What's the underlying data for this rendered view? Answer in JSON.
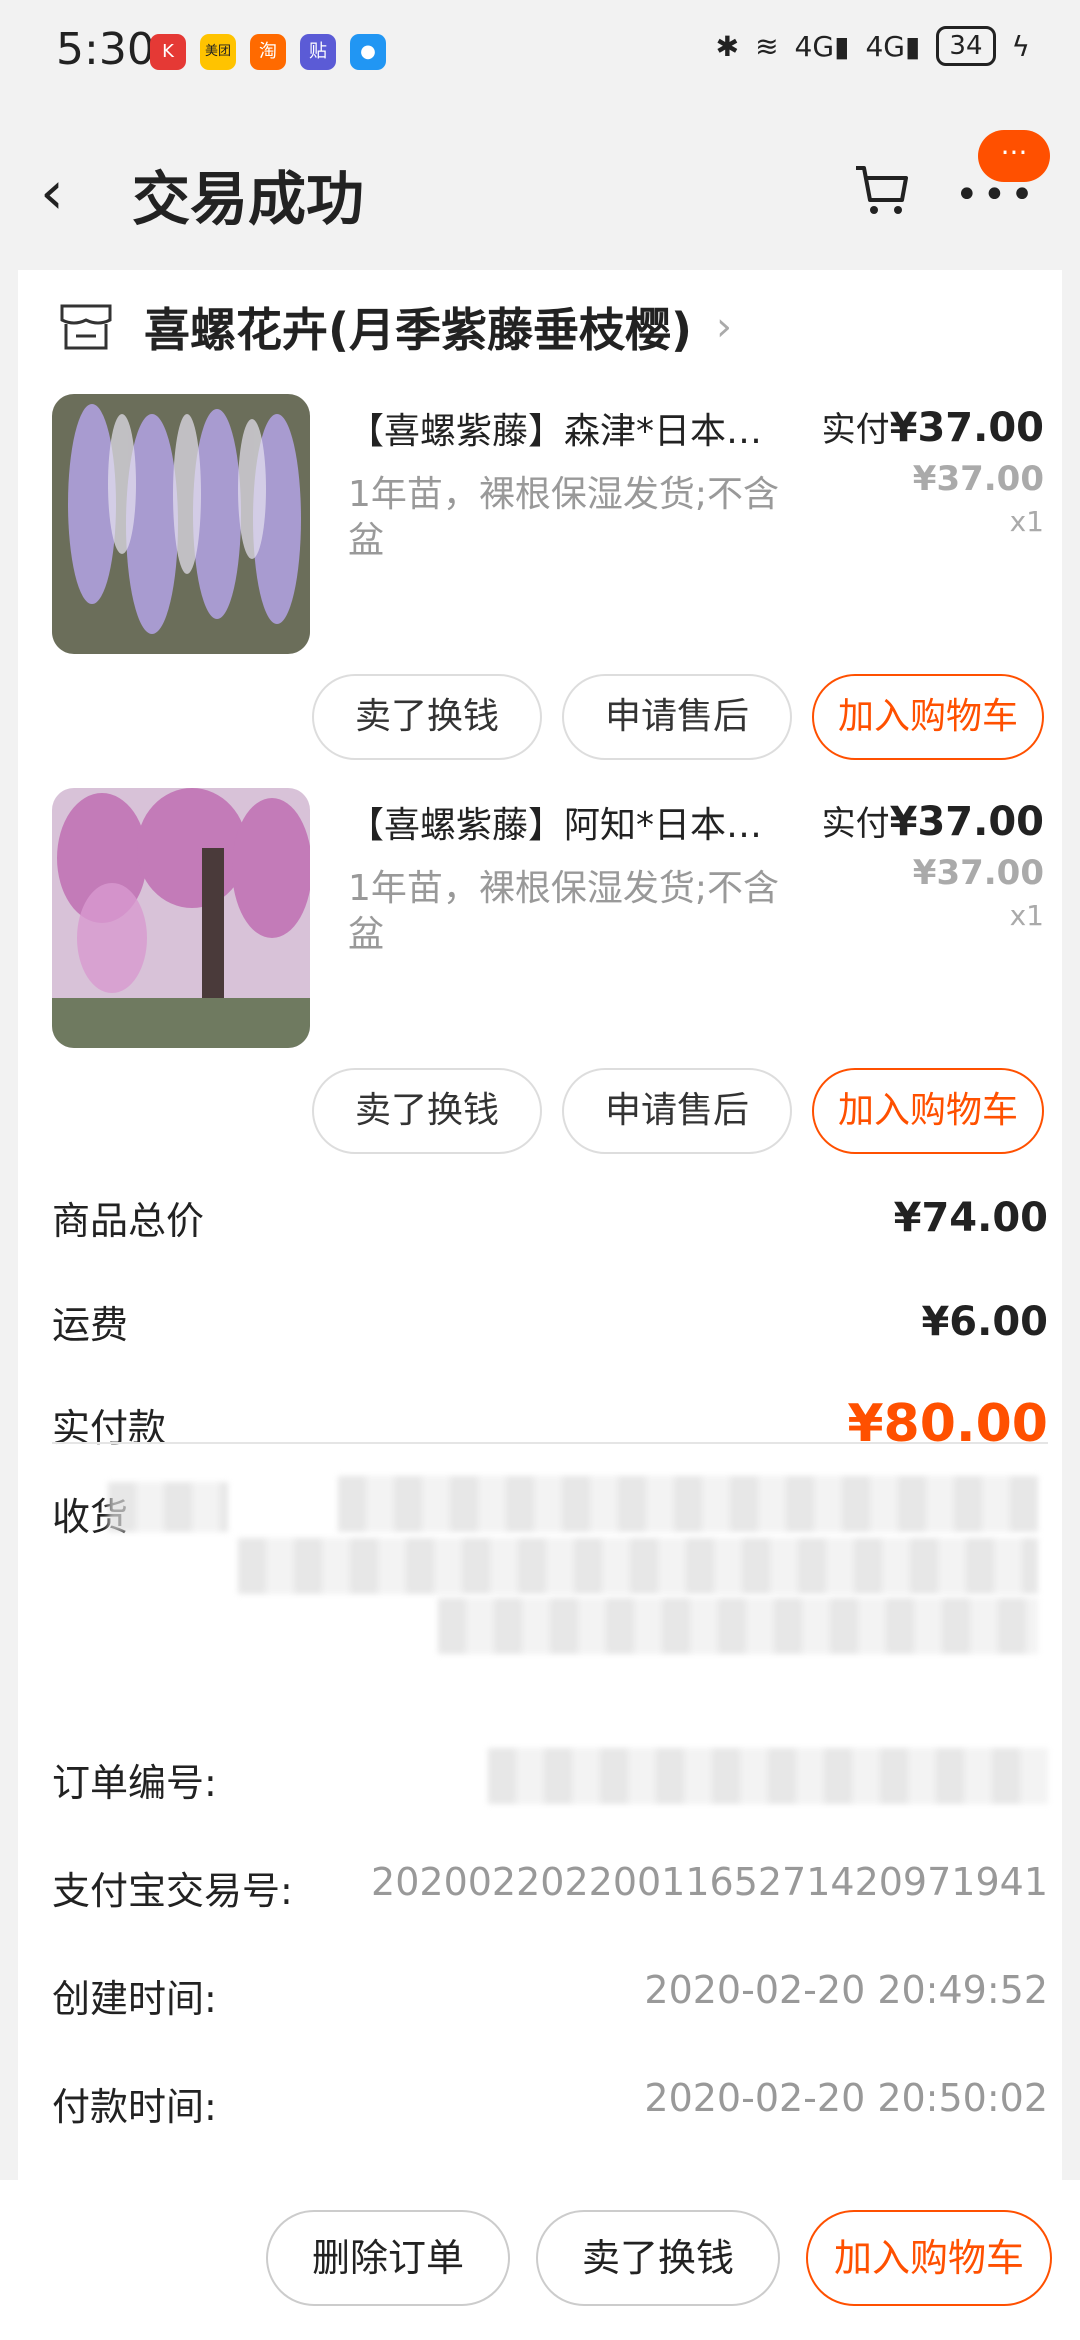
{
  "status": {
    "time": "5:30",
    "battery": "34",
    "signal1": "4G",
    "signal2": "4G",
    "apps": [
      {
        "name": "app-icon-red",
        "glyph": "K",
        "color": "#e53935"
      },
      {
        "name": "app-icon-meituan",
        "glyph": "美团",
        "color": "#ffc300"
      },
      {
        "name": "app-icon-taobao",
        "glyph": "淘",
        "color": "#ff6a00"
      },
      {
        "name": "app-icon-tieba",
        "glyph": "贴",
        "color": "#5b5bd6"
      },
      {
        "name": "app-icon-message",
        "glyph": "●",
        "color": "#2196f3"
      }
    ]
  },
  "header": {
    "title": "交易成功",
    "badge": "···"
  },
  "shop": {
    "name": "喜螺花卉(月季紫藤垂枝樱)"
  },
  "items": [
    {
      "title": "【喜螺紫藤】森津*日本…",
      "spec": "1年苗，裸根保湿发货;不含盆",
      "paid_label": "实付",
      "paid_price": "¥37.00",
      "orig_price": "¥37.00",
      "qty": "x1",
      "thumb_color": "#8c7bb0",
      "buttons": [
        "卖了换钱",
        "申请售后",
        "加入购物车"
      ]
    },
    {
      "title": "【喜螺紫藤】阿知*日本…",
      "spec": "1年苗，裸根保湿发货;不含盆",
      "paid_label": "实付",
      "paid_price": "¥37.00",
      "orig_price": "¥37.00",
      "qty": "x1",
      "thumb_color": "#c48ab8",
      "buttons": [
        "卖了换钱",
        "申请售后",
        "加入购物车"
      ]
    }
  ],
  "summary": {
    "goods_total_label": "商品总价",
    "goods_total": "¥74.00",
    "shipping_label": "运费",
    "shipping": "¥6.00",
    "paid_label": "实付款",
    "paid": "¥80.00"
  },
  "info": {
    "receiver_label": "收货",
    "order_no_label": "订单编号:",
    "alipay_label": "支付宝交易号:",
    "alipay_no": "2020022022001165271420971941",
    "created_label": "创建时间:",
    "created": "2020-02-20 20:49:52",
    "paid_time_label": "付款时间:",
    "paid_time": "2020-02-20 20:50:02"
  },
  "bottom": {
    "delete": "删除订单",
    "sell": "卖了换钱",
    "add_cart": "加入购物车"
  },
  "colors": {
    "accent": "#ff5000",
    "muted": "#999999"
  }
}
